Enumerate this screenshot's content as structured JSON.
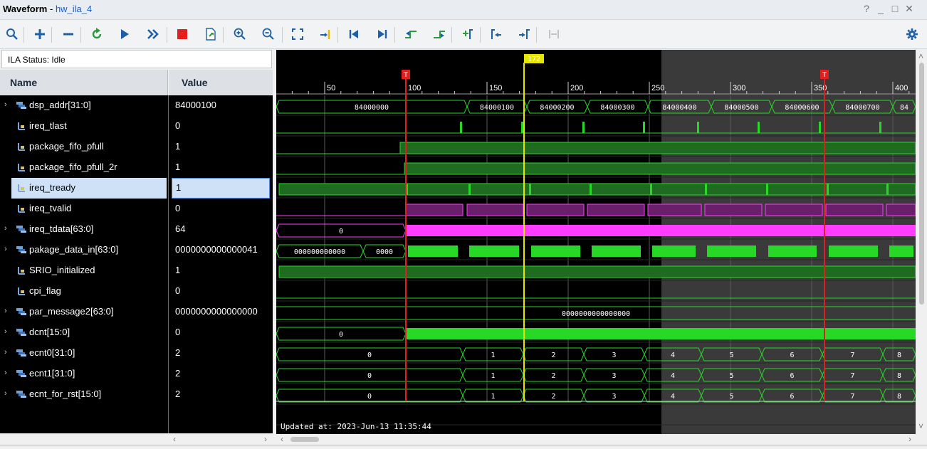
{
  "window": {
    "title": "Waveform",
    "separator": " - ",
    "file": "hw_ila_4",
    "controls": [
      "?",
      "_",
      "□",
      "✕"
    ]
  },
  "toolbar": {
    "buttons": [
      "search-icon",
      "zoom-add-icon",
      "remove-icon",
      "refresh-icon",
      "run-trigger-icon",
      "run-immediate-icon",
      "stop-icon",
      "export-icon",
      "zoom-in-icon",
      "zoom-out-icon",
      "zoom-fit-icon",
      "go-to-cursor-icon",
      "go-to-start-icon",
      "go-to-end-icon",
      "previous-transition-icon",
      "next-transition-icon",
      "add-marker-icon",
      "previous-marker-icon",
      "next-marker-icon",
      "swap-cursors-icon",
      "settings-icon"
    ]
  },
  "status": {
    "text": "ILA Status:  Idle"
  },
  "columns": {
    "name": "Name",
    "value": "Value"
  },
  "signals": [
    {
      "name": "dsp_addr[31:0]",
      "value": "84000100",
      "bus": true
    },
    {
      "name": "ireq_tlast",
      "value": "0",
      "bus": false
    },
    {
      "name": "package_fifo_pfull",
      "value": "1",
      "bus": false
    },
    {
      "name": "package_fifo_pfull_2r",
      "value": "1",
      "bus": false
    },
    {
      "name": "ireq_tready",
      "value": "1",
      "bus": false,
      "selected": true
    },
    {
      "name": "ireq_tvalid",
      "value": "0",
      "bus": false
    },
    {
      "name": "ireq_tdata[63:0]",
      "value": "64",
      "bus": true
    },
    {
      "name": "pakage_data_in[63:0]",
      "value": "0000000000000041",
      "bus": true
    },
    {
      "name": "SRIO_initialized",
      "value": "1",
      "bus": false
    },
    {
      "name": "cpi_flag",
      "value": "0",
      "bus": false
    },
    {
      "name": "par_message2[63:0]",
      "value": "0000000000000000",
      "bus": true
    },
    {
      "name": "dcnt[15:0]",
      "value": "0",
      "bus": true
    },
    {
      "name": "ecnt0[31:0]",
      "value": "2",
      "bus": true
    },
    {
      "name": "ecnt1[31:0]",
      "value": "2",
      "bus": true
    },
    {
      "name": "ecnt_for_rst[15:0]",
      "value": "2",
      "bus": true
    }
  ],
  "waveform": {
    "ruler_labels": [
      "50",
      "100",
      "150",
      "200",
      "250",
      "300",
      "350",
      "400"
    ],
    "cursor_label": "172",
    "trigger_markers": [
      "T",
      "T"
    ],
    "dsp_addr_values": [
      "84000000",
      "84000100",
      "84000200",
      "84000300",
      "84000400",
      "84000500",
      "84000600",
      "84000700",
      "84"
    ],
    "ireq_tdata_value": "0",
    "pakage_data_values": [
      "000000000000",
      "0000"
    ],
    "par_message2_value": "0000000000000000",
    "dcnt_value": "0",
    "ecnt_values": [
      "0",
      "1",
      "2",
      "3",
      "4",
      "5",
      "6",
      "7",
      "8"
    ],
    "updated": "Updated at: 2023-Jun-13 11:35:44"
  },
  "colors": {
    "wave_green": "#27d827",
    "wave_magenta": "#ff3cff",
    "cursor": "#e6e600",
    "trigger": "#e02020",
    "selected_row": "#cfe1f7"
  }
}
